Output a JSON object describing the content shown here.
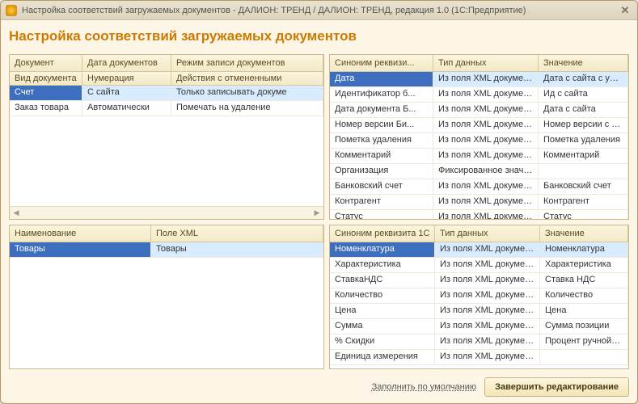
{
  "window": {
    "title": "Настройка соответствий загружаемых документов - ДАЛИОН: ТРЕНД / ДАЛИОН: ТРЕНД, редакция 1.0   (1С:Предприятие)"
  },
  "page_title": "Настройка соответствий загружаемых документов",
  "grid_top_left": {
    "columns": [
      "Документ",
      "Дата документов",
      "Режим записи документов"
    ],
    "subheader": [
      "Вид документа",
      "Нумерация",
      "Действия с отмененными"
    ],
    "rows": [
      {
        "cells": [
          "Счет",
          "С сайта",
          "Только записывать докуме"
        ],
        "selected": true
      },
      {
        "cells": [
          "Заказ товара",
          "Автоматически",
          "Помечать на удаление"
        ],
        "selected": false
      }
    ]
  },
  "grid_top_right": {
    "columns": [
      "Синоним реквизи...",
      "Тип данных",
      "Значение"
    ],
    "rows": [
      {
        "cells": [
          "Дата",
          "Из поля XML документа",
          "Дата с сайта с учетом на..."
        ],
        "selected": true
      },
      {
        "cells": [
          "Идентификатор б...",
          "Из поля XML документа",
          "Ид с сайта"
        ]
      },
      {
        "cells": [
          "Дата документа Б...",
          "Из поля XML документа",
          "Дата с сайта"
        ]
      },
      {
        "cells": [
          "Номер версии Би...",
          "Из поля XML документа",
          "Номер версии с сайта"
        ]
      },
      {
        "cells": [
          "Пометка удаления",
          "Из поля XML документа",
          "Пометка удаления"
        ]
      },
      {
        "cells": [
          "Комментарий",
          "Из поля XML документа",
          "Комментарий"
        ]
      },
      {
        "cells": [
          "Организация",
          "Фиксированное значе...",
          ""
        ]
      },
      {
        "cells": [
          "Банковский счет",
          "Из поля XML документа",
          "Банковский счет"
        ]
      },
      {
        "cells": [
          "Контрагент",
          "Из поля XML документа",
          "Контрагент"
        ]
      },
      {
        "cells": [
          "Статус",
          "Из поля XML документа",
          "Статус"
        ]
      }
    ]
  },
  "grid_bot_left": {
    "columns": [
      "Наименование",
      "Поле XML"
    ],
    "rows": [
      {
        "cells": [
          "Товары",
          "Товары"
        ],
        "selected": true
      }
    ]
  },
  "grid_bot_right": {
    "columns": [
      "Синоним реквизита 1С",
      "Тип данных",
      "Значение"
    ],
    "rows": [
      {
        "cells": [
          "Номенклатура",
          "Из поля XML документа",
          "Номенклатура"
        ],
        "selected": true
      },
      {
        "cells": [
          "Характеристика",
          "Из поля XML документа",
          "Характеристика"
        ]
      },
      {
        "cells": [
          "СтавкаНДС",
          "Из поля XML документа",
          "Ставка НДС"
        ]
      },
      {
        "cells": [
          "Количество",
          "Из поля XML документа",
          "Количество"
        ]
      },
      {
        "cells": [
          "Цена",
          "Из поля XML документа",
          "Цена"
        ]
      },
      {
        "cells": [
          "Сумма",
          "Из поля XML документа",
          "Сумма позиции"
        ]
      },
      {
        "cells": [
          "% Скидки",
          "Из поля XML документа",
          "Процент ручной скидки"
        ]
      },
      {
        "cells": [
          "Единица измерения",
          "Из поля XML документа",
          ""
        ]
      }
    ]
  },
  "footer": {
    "fill_default": "Заполнить по умолчанию",
    "finish": "Завершить редактирование"
  }
}
